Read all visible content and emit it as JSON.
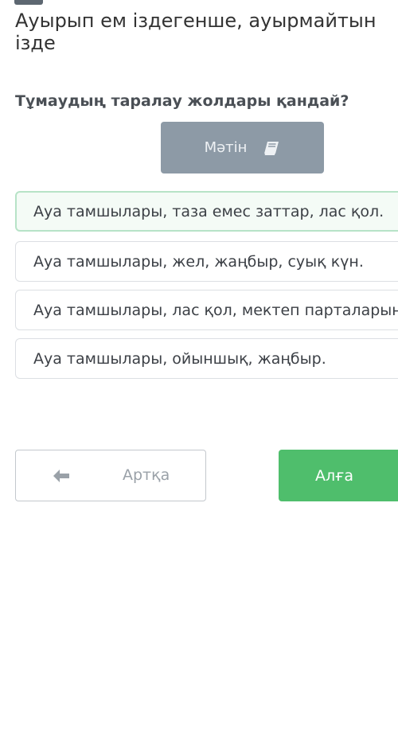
{
  "header": {
    "title": "Ауырып ем іздегенше, ауырмайтын жол іздe"
  },
  "question": {
    "text": "Тұмаудың таралау жолдары қандай?"
  },
  "text_button": {
    "label": "Мәтін",
    "icon": "book-icon"
  },
  "options": [
    {
      "label": "Ауа тамшылары, таза емес заттар, лас қол.",
      "selected": true
    },
    {
      "label": "Ауа тамшылары, жел, жаңбыр, суық күн.",
      "selected": false
    },
    {
      "label": "Ауа тамшылары, лас қол, мектеп парталарынан.",
      "selected": false
    },
    {
      "label": "Ауа тамшылары, ойыншық, жаңбыр.",
      "selected": false
    }
  ],
  "navigation": {
    "back_label": "Артқа",
    "back_icon": "arrow-left-icon",
    "next_label": "Алға"
  },
  "colors": {
    "selected_border": "#b7e3c7",
    "next_button": "#4fbe6c",
    "text_button": "#8d9aa6"
  }
}
